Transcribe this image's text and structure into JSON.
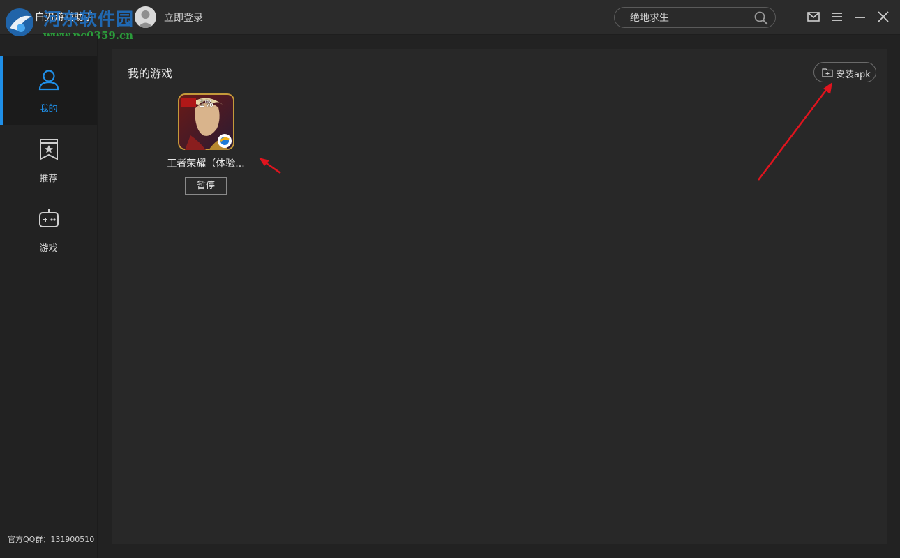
{
  "titlebar": {
    "app_title": "白刃游戏助手",
    "login_label": "立即登录",
    "watermark_title": "河东软件园",
    "watermark_url": "www.pc0359.cn",
    "search_value": "绝地求生",
    "icons": [
      "mail-icon",
      "menu-icon",
      "minimize-icon",
      "close-icon",
      "search-icon"
    ]
  },
  "sidebar": {
    "items": [
      {
        "label": "我的",
        "icon": "user-icon",
        "active": true
      },
      {
        "label": "推荐",
        "icon": "star-bookmark-icon",
        "active": false
      },
      {
        "label": "游戏",
        "icon": "gamepad-icon",
        "active": false
      }
    ],
    "qq_group": "官方QQ群：131900510"
  },
  "main": {
    "section_title": "我的游戏",
    "install_label": "安装apk",
    "games": [
      {
        "name": "王者荣耀（体验...",
        "progress": "1%",
        "action_label": "暂停"
      }
    ]
  },
  "colors": {
    "accent": "#1f8fe8",
    "background": "#222222",
    "panel": "#282828",
    "annotation_arrow": "#e0141e"
  }
}
